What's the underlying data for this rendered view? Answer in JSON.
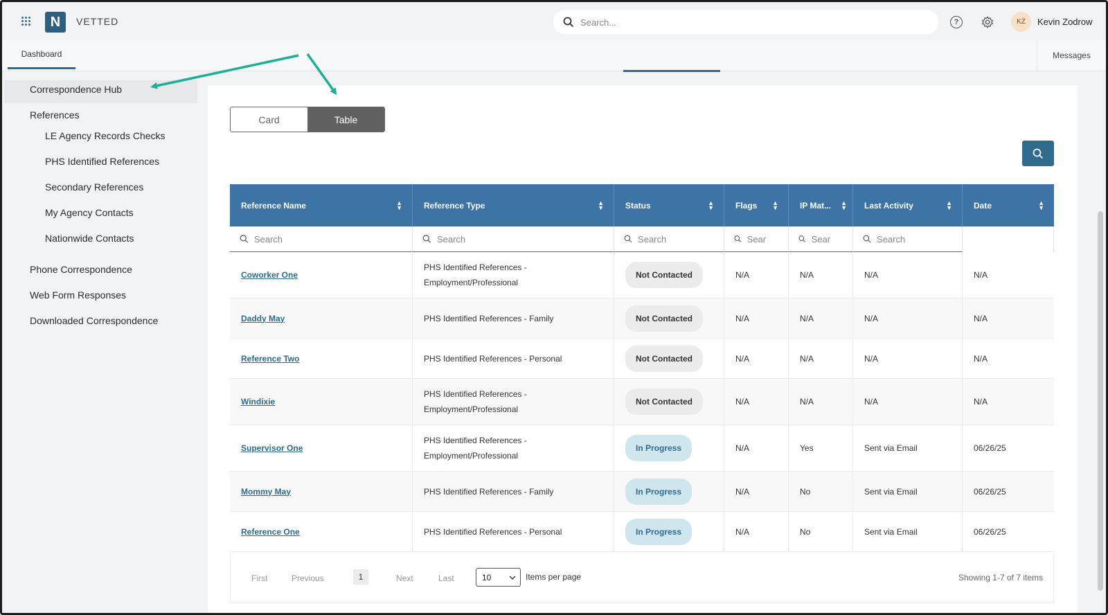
{
  "app": {
    "brand": "VETTED",
    "logo_letter": "N"
  },
  "header": {
    "search_placeholder": "Search...",
    "help_glyph": "?",
    "user_initials": "KZ",
    "user_name": "Kevin Zodrow"
  },
  "nav": {
    "dashboard": "Dashboard",
    "messages": "Messages"
  },
  "sidebar": {
    "items": [
      {
        "label": "Correspondence Hub",
        "active": true
      },
      {
        "label": "References"
      },
      {
        "label": "LE Agency Records Checks"
      },
      {
        "label": "PHS Identified References"
      },
      {
        "label": "Secondary References"
      },
      {
        "label": "My Agency Contacts"
      },
      {
        "label": "Nationwide Contacts"
      },
      {
        "label": "Phone Correspondence"
      },
      {
        "label": "Web Form Responses"
      },
      {
        "label": "Downloaded Correspondence"
      }
    ]
  },
  "view_toggle": {
    "card": "Card",
    "table": "Table",
    "selected": "Table"
  },
  "table": {
    "columns": [
      "Reference Name",
      "Reference Type",
      "Status",
      "Flags",
      "IP Mat...",
      "Last Activity",
      "Date"
    ],
    "filter_placeholders": [
      "Search",
      "Search",
      "Search",
      "Sear",
      "Sear",
      "Search"
    ],
    "rows": [
      {
        "name": "Coworker One",
        "type": "PHS Identified References - Employment/Professional",
        "status": "Not Contacted",
        "flags": "N/A",
        "ip": "N/A",
        "activity": "N/A",
        "date": "N/A"
      },
      {
        "name": "Daddy May",
        "type": "PHS Identified References - Family",
        "status": "Not Contacted",
        "flags": "N/A",
        "ip": "N/A",
        "activity": "N/A",
        "date": "N/A"
      },
      {
        "name": "Reference Two",
        "type": "PHS Identified References - Personal",
        "status": "Not Contacted",
        "flags": "N/A",
        "ip": "N/A",
        "activity": "N/A",
        "date": "N/A"
      },
      {
        "name": "Windixie",
        "type": "PHS Identified References - Employment/Professional",
        "status": "Not Contacted",
        "flags": "N/A",
        "ip": "N/A",
        "activity": "N/A",
        "date": "N/A"
      },
      {
        "name": "Supervisor One",
        "type": "PHS Identified References - Employment/Professional",
        "status": "In Progress",
        "flags": "N/A",
        "ip": "Yes",
        "activity": "Sent via Email",
        "date": "06/26/25"
      },
      {
        "name": "Mommy May",
        "type": "PHS Identified References - Family",
        "status": "In Progress",
        "flags": "N/A",
        "ip": "No",
        "activity": "Sent via Email",
        "date": "06/26/25"
      },
      {
        "name": "Reference One",
        "type": "PHS Identified References - Personal",
        "status": "In Progress",
        "flags": "N/A",
        "ip": "No",
        "activity": "Sent via Email",
        "date": "06/26/25"
      }
    ]
  },
  "pagination": {
    "first": "First",
    "previous": "Previous",
    "current_page": "1",
    "next": "Next",
    "last": "Last",
    "per_page": "10",
    "per_page_label": "Items per page",
    "showing": "Showing 1-7 of 7 items"
  },
  "colors": {
    "header_blue": "#3d74a5",
    "accent": "#2e6b8c",
    "arrow": "#1fae96"
  }
}
